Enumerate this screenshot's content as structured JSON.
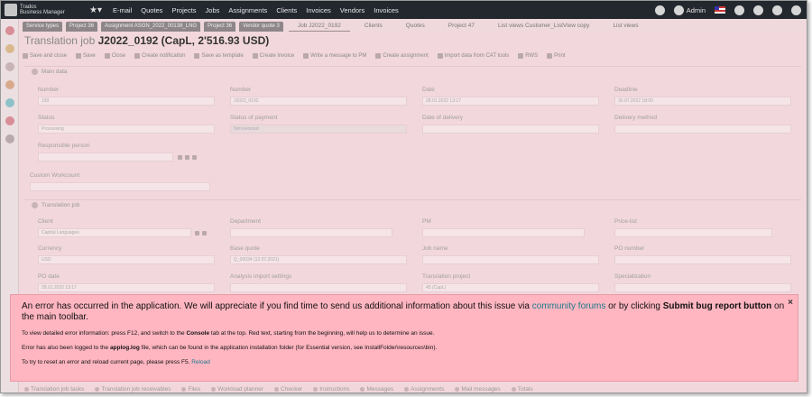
{
  "app": {
    "logo_line1": "Trados",
    "logo_line2": "Business Manager"
  },
  "topnav": {
    "items": [
      "E-mail",
      "Quotes",
      "Projects",
      "Jobs",
      "Assignments",
      "Clients",
      "Invoices",
      "Vendors",
      "Invoices"
    ],
    "user": "Admin"
  },
  "window_tabs": [
    "Service types",
    "Project 36",
    "Assignment ASGN_2022_00138_LNG",
    "Project 36",
    "Vendor quote 3"
  ],
  "right_tabs": [
    "Job J2022_0192",
    "Clients",
    "Quotes",
    "Project 47",
    "List views Customer_ListView copy",
    "List views"
  ],
  "page": {
    "title_prefix": "Translation job ",
    "title_bold": "J2022_0192 (CapL, 2'516.93 USD)"
  },
  "toolbar": [
    "Save and close",
    "Save",
    "Close",
    "Create notification",
    "Save as template",
    "Create invoice",
    "Write a message to PM",
    "Create assignment",
    "Import data from CAT tools",
    "RWS",
    "Print"
  ],
  "main_data": {
    "header": "Main data",
    "fields": {
      "number_label": "Number",
      "number_value": "193",
      "number2_label": "Number",
      "number2_value": "J2022_0192",
      "date_label": "Date",
      "date_value": "28.01.2022 13:17",
      "deadline_label": "Deadline",
      "deadline_value": "30.07.2022 18:00",
      "status_label": "Status",
      "status_value": "Processing",
      "payment_label": "Status of payment",
      "payment_value": "Not invoiced",
      "delivery_date_label": "Date of delivery",
      "delivery_method_label": "Delivery method",
      "responsible_label": "Responsible person",
      "custom_workcount_label": "Custom Workcount"
    }
  },
  "translation_job": {
    "header": "Translation job",
    "fields": {
      "client_label": "Client",
      "client_value": "Capital Languages",
      "department_label": "Department",
      "pm_label": "PM",
      "pricelist_label": "Price-list",
      "currency_label": "Currency",
      "currency_value": "USD",
      "basequote_label": "Base quote",
      "basequote_value": "Q_00034 (12.07.2021)",
      "jobname_label": "Job name",
      "ponumber_label": "PO number",
      "podate_label": "PO date",
      "podate_value": "28.01.2022 13:17",
      "analysis_label": "Analysis import settings",
      "transproject_label": "Translation project",
      "transproject_value": "45 (CapL)",
      "specialization_label": "Specialization"
    }
  },
  "bottom_tabs": [
    "Translation job tasks",
    "Translation job receivables",
    "Files",
    "Workload planner",
    "Checker",
    "Instructions",
    "Messages",
    "Assignments",
    "Mail messages",
    "Totals"
  ],
  "error": {
    "main_part1": "An error has occurred in the application. We will appreciate if you find time to send us additional information about this issue via ",
    "main_link": "community forums",
    "main_part2": " or by clicking ",
    "main_bold": "Submit bug report button",
    "main_part3": " on the main toolbar.",
    "line1_part1": "To view detailed error information: press F12, and switch to the ",
    "line1_bold": "Console",
    "line1_part2": " tab at the top. Red text, starting from the beginning, will help us to determine an issue.",
    "line2_part1": "Error has also been logged to the ",
    "line2_bold": "applog.log",
    "line2_part2": " file, which can be found in the application installation folder (for Essential version, see InstallFolder\\resources\\bin).",
    "line3_part1": "To try to reset an error and reload current page, please press F5. ",
    "line3_link": "Reload",
    "close_glyph": "×"
  },
  "colors": {
    "error_bg": "#ffb6c1",
    "link": "#1a7a8c",
    "nav_bg": "#23272e"
  }
}
